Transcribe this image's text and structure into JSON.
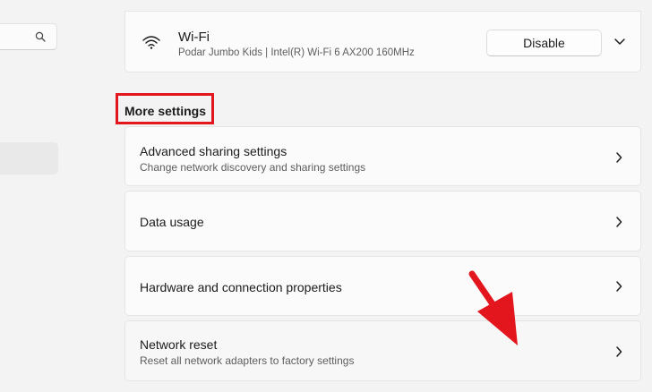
{
  "wifi": {
    "title": "Wi-Fi",
    "subtitle": "Podar Jumbo Kids | Intel(R) Wi-Fi 6 AX200 160MHz",
    "disable_label": "Disable"
  },
  "more_settings": {
    "heading": "More settings",
    "rows": [
      {
        "title": "Advanced sharing settings",
        "subtitle": "Change network discovery and sharing settings"
      },
      {
        "title": "Data usage",
        "subtitle": ""
      },
      {
        "title": "Hardware and connection properties",
        "subtitle": ""
      },
      {
        "title": "Network reset",
        "subtitle": "Reset all network adapters to factory settings"
      }
    ]
  },
  "icons": {
    "search": "search-icon",
    "wifi": "wifi-icon",
    "expand": "chevron-down-icon",
    "row": "chevron-right-icon"
  },
  "colors": {
    "highlight": "#e3151d",
    "background": "#f3f3f3",
    "card": "#fbfbfb"
  }
}
